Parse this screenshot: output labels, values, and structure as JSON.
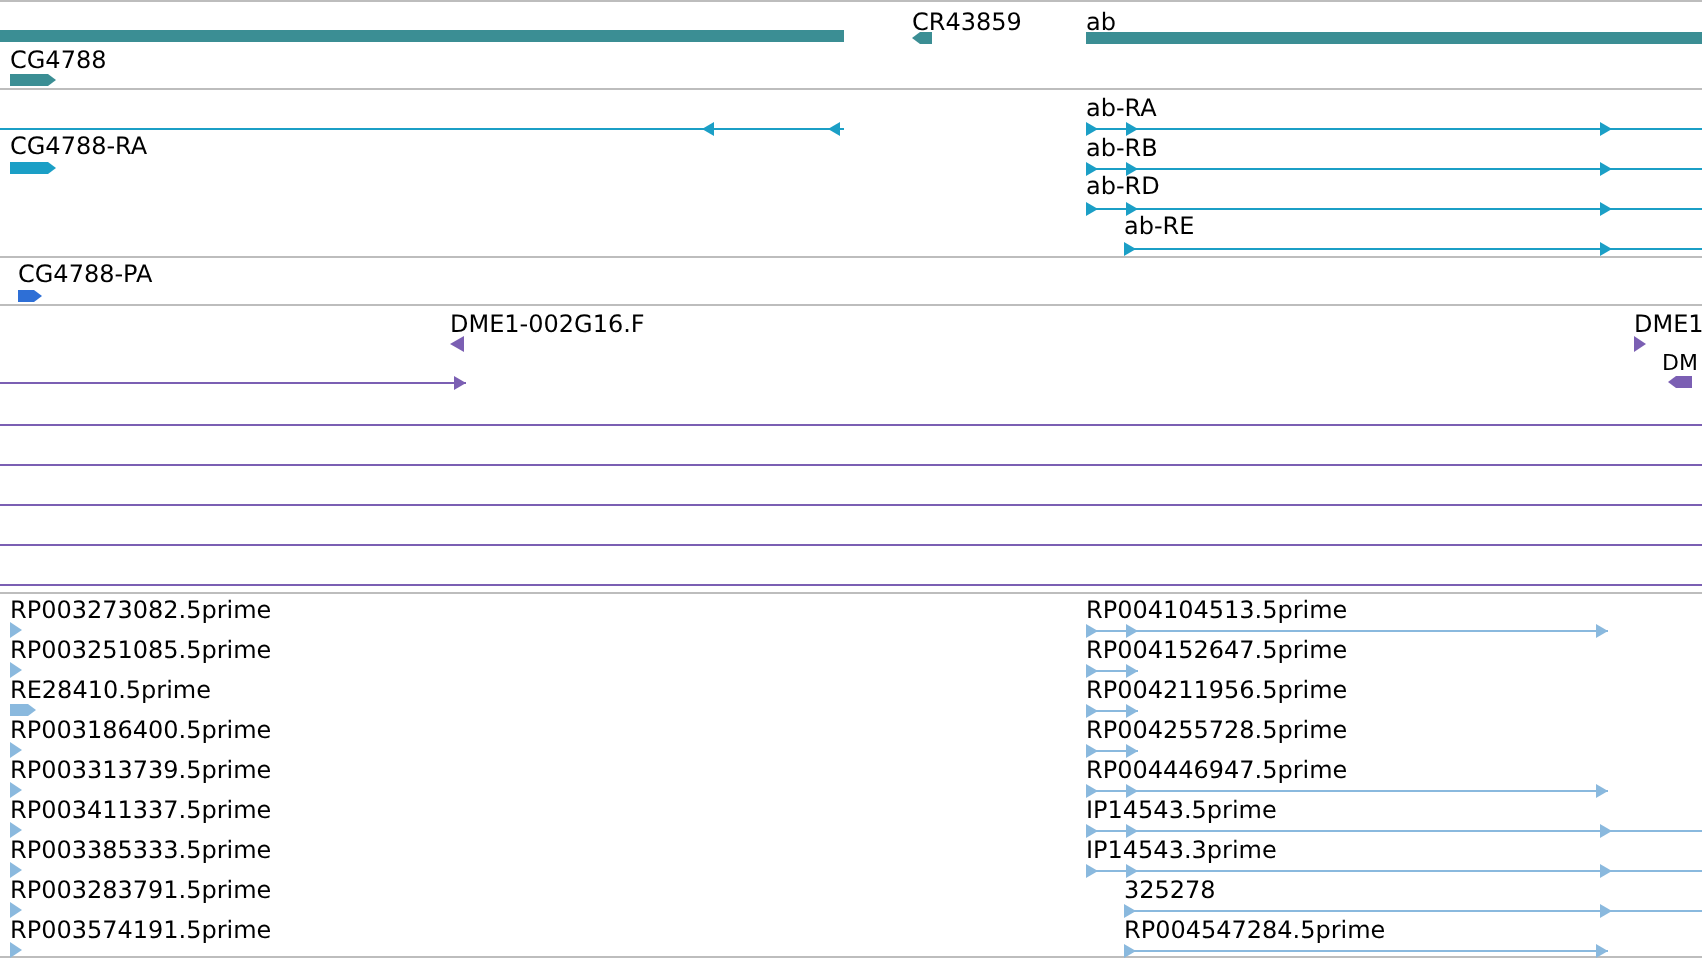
{
  "tracks": [
    {
      "color": "#3b8e94",
      "features": [
        {
          "kind": "block"
        },
        {
          "kind": "block",
          "label": "CR43859",
          "reverse": true
        },
        {
          "kind": "block",
          "label": "ab"
        },
        {
          "kind": "block",
          "label": "CG4788",
          "reverse": false
        }
      ]
    },
    {
      "color": "#1b9fc6",
      "features": [
        {
          "kind": "transcript",
          "reverse": true
        },
        {
          "kind": "transcript",
          "label": "ab-RA",
          "reverse": false
        },
        {
          "kind": "block",
          "label": "CG4788-RA",
          "reverse": false
        },
        {
          "kind": "transcript",
          "label": "ab-RB",
          "reverse": false
        },
        {
          "kind": "transcript",
          "label": "ab-RD",
          "reverse": false
        },
        {
          "kind": "transcript",
          "label": "ab-RE",
          "reverse": false
        }
      ]
    },
    {
      "color": "#2e6fd6",
      "features": [
        {
          "kind": "block",
          "label": "CG4788-PA",
          "reverse": false
        }
      ]
    },
    {
      "color": "#7b5fb3",
      "features": [
        {
          "kind": "marker",
          "label": "DME1-002G16.F",
          "reverse": true
        },
        {
          "kind": "transcript",
          "reverse": false
        },
        {
          "kind": "marker",
          "label": "DME1",
          "reverse": false
        },
        {
          "kind": "block",
          "label": "DM",
          "reverse": true
        },
        {
          "kind": "line"
        },
        {
          "kind": "line"
        },
        {
          "kind": "line"
        },
        {
          "kind": "line"
        },
        {
          "kind": "line"
        }
      ]
    },
    {
      "color": "#8ab9de",
      "features": [
        {
          "kind": "marker",
          "label": "RP003273082.5prime",
          "reverse": false
        },
        {
          "kind": "marker",
          "label": "RP003251085.5prime",
          "reverse": false
        },
        {
          "kind": "block",
          "label": "RE28410.5prime",
          "reverse": false
        },
        {
          "kind": "marker",
          "label": "RP003186400.5prime",
          "reverse": false
        },
        {
          "kind": "marker",
          "label": "RP003313739.5prime",
          "reverse": false
        },
        {
          "kind": "marker",
          "label": "RP003411337.5prime",
          "reverse": false
        },
        {
          "kind": "marker",
          "label": "RP003385333.5prime",
          "reverse": false
        },
        {
          "kind": "marker",
          "label": "RP003283791.5prime",
          "reverse": false
        },
        {
          "kind": "marker",
          "label": "RP003574191.5prime",
          "reverse": false
        },
        {
          "kind": "transcript",
          "label": "RP004104513.5prime",
          "reverse": false
        },
        {
          "kind": "transcript",
          "label": "RP004152647.5prime",
          "reverse": false
        },
        {
          "kind": "transcript",
          "label": "RP004211956.5prime",
          "reverse": false
        },
        {
          "kind": "transcript",
          "label": "RP004255728.5prime",
          "reverse": false
        },
        {
          "kind": "transcript",
          "label": "RP004446947.5prime",
          "reverse": false
        },
        {
          "kind": "transcript",
          "label": "IP14543.5prime",
          "reverse": false
        },
        {
          "kind": "transcript",
          "label": "IP14543.3prime",
          "reverse": false
        },
        {
          "kind": "transcript",
          "label": "325278",
          "reverse": false
        },
        {
          "kind": "transcript",
          "label": "RP004547284.5prime",
          "reverse": false
        }
      ]
    }
  ]
}
